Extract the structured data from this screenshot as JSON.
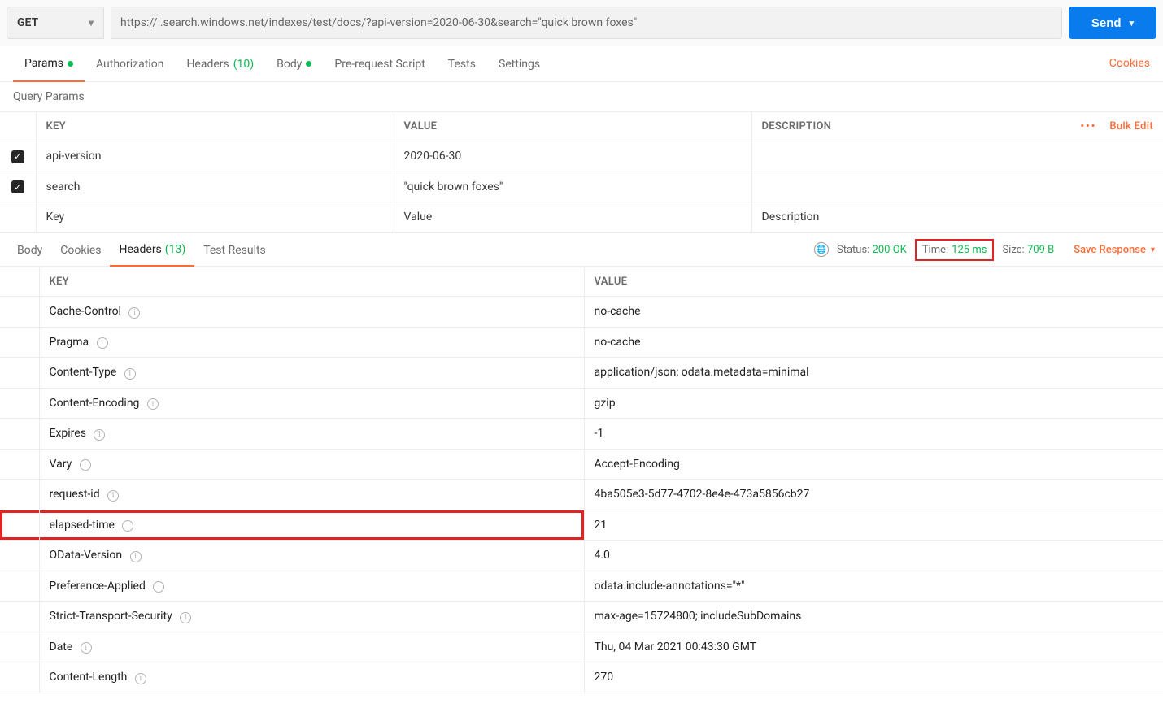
{
  "request": {
    "method": "GET",
    "url": "https://        .search.windows.net/indexes/test/docs/?api-version=2020-06-30&search=\"quick brown foxes\"",
    "send_label": "Send"
  },
  "request_tabs": {
    "params": "Params",
    "authorization": "Authorization",
    "headers": "Headers",
    "headers_count": "(10)",
    "body": "Body",
    "prerequest": "Pre-request Script",
    "tests": "Tests",
    "settings": "Settings",
    "cookies": "Cookies"
  },
  "query_params": {
    "title": "Query Params",
    "col_key": "KEY",
    "col_value": "VALUE",
    "col_desc": "DESCRIPTION",
    "bulk_edit": "Bulk Edit",
    "rows": [
      {
        "checked": true,
        "key": "api-version",
        "value": "2020-06-30",
        "desc": ""
      },
      {
        "checked": true,
        "key": "search",
        "value": "\"quick brown foxes\"",
        "desc": ""
      }
    ],
    "placeholder_key": "Key",
    "placeholder_value": "Value",
    "placeholder_desc": "Description"
  },
  "response_tabs": {
    "body": "Body",
    "cookies": "Cookies",
    "headers": "Headers",
    "headers_count": "(13)",
    "test_results": "Test Results"
  },
  "response_meta": {
    "status_label": "Status:",
    "status_value": "200 OK",
    "time_label": "Time:",
    "time_value": "125 ms",
    "size_label": "Size:",
    "size_value": "709 B",
    "save_response": "Save Response"
  },
  "response_headers": {
    "col_key": "KEY",
    "col_value": "VALUE",
    "rows": [
      {
        "key": "Cache-Control",
        "value": "no-cache",
        "highlight": false
      },
      {
        "key": "Pragma",
        "value": "no-cache",
        "highlight": false
      },
      {
        "key": "Content-Type",
        "value": "application/json; odata.metadata=minimal",
        "highlight": false
      },
      {
        "key": "Content-Encoding",
        "value": "gzip",
        "highlight": false
      },
      {
        "key": "Expires",
        "value": "-1",
        "highlight": false
      },
      {
        "key": "Vary",
        "value": "Accept-Encoding",
        "highlight": false
      },
      {
        "key": "request-id",
        "value": "4ba505e3-5d77-4702-8e4e-473a5856cb27",
        "highlight": false
      },
      {
        "key": "elapsed-time",
        "value": "21",
        "highlight": true
      },
      {
        "key": "OData-Version",
        "value": "4.0",
        "highlight": false
      },
      {
        "key": "Preference-Applied",
        "value": "odata.include-annotations=\"*\"",
        "highlight": false
      },
      {
        "key": "Strict-Transport-Security",
        "value": "max-age=15724800; includeSubDomains",
        "highlight": false
      },
      {
        "key": "Date",
        "value": "Thu, 04 Mar 2021 00:43:30 GMT",
        "highlight": false
      },
      {
        "key": "Content-Length",
        "value": "270",
        "highlight": false
      }
    ]
  }
}
